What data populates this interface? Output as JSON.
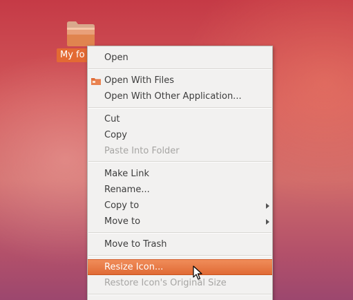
{
  "desktop": {
    "folder_label": "My fo"
  },
  "menu": {
    "items": [
      {
        "label": "Open",
        "enabled": true
      },
      {
        "label": "Open With Files",
        "enabled": true,
        "icon": "files-app-icon"
      },
      {
        "label": "Open With Other Application...",
        "enabled": true
      },
      {
        "label": "Cut",
        "enabled": true
      },
      {
        "label": "Copy",
        "enabled": true
      },
      {
        "label": "Paste Into Folder",
        "enabled": false
      },
      {
        "label": "Make Link",
        "enabled": true
      },
      {
        "label": "Rename...",
        "enabled": true
      },
      {
        "label": "Copy to",
        "enabled": true,
        "submenu": true
      },
      {
        "label": "Move to",
        "enabled": true,
        "submenu": true
      },
      {
        "label": "Move to Trash",
        "enabled": true
      },
      {
        "label": "Resize Icon...",
        "enabled": true,
        "highlighted": true
      },
      {
        "label": "Restore Icon's Original Size",
        "enabled": false
      }
    ]
  },
  "colors": {
    "highlight": "#e8763f",
    "menu_background": "#f2f1f0",
    "desktop_top": "#c53a46",
    "desktop_bottom": "#9c476e"
  }
}
